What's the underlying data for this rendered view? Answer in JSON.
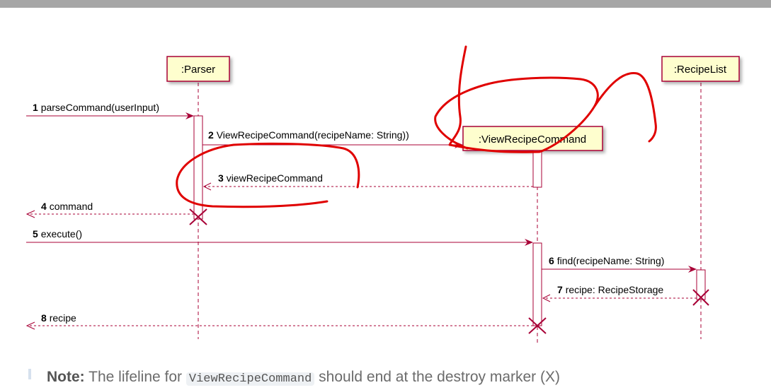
{
  "participants": [
    {
      "id": "parser",
      "label": ":Parser"
    },
    {
      "id": "viewrecipecommand",
      "label": ":ViewRecipeCommand"
    },
    {
      "id": "recipelist",
      "label": ":RecipeList"
    }
  ],
  "messages": [
    {
      "num": "1",
      "text": "parseCommand(userInput)"
    },
    {
      "num": "2",
      "text": "ViewRecipeCommand(recipeName: String))"
    },
    {
      "num": "3",
      "text": "viewRecipeCommand"
    },
    {
      "num": "4",
      "text": "command"
    },
    {
      "num": "5",
      "text": "execute()"
    },
    {
      "num": "6",
      "text": "find(recipeName: String)"
    },
    {
      "num": "7",
      "text": "recipe: RecipeStorage"
    },
    {
      "num": "8",
      "text": "recipe"
    }
  ],
  "note": {
    "label": "Note:",
    "text_before": "The lifeline for",
    "code": "ViewRecipeCommand",
    "text_after": "should end at the destroy marker (X)"
  },
  "colors": {
    "arrow": "#a80036",
    "participant_fill": "#fefece",
    "annotation": "#e00000",
    "top_bar": "#a6a6a6"
  }
}
